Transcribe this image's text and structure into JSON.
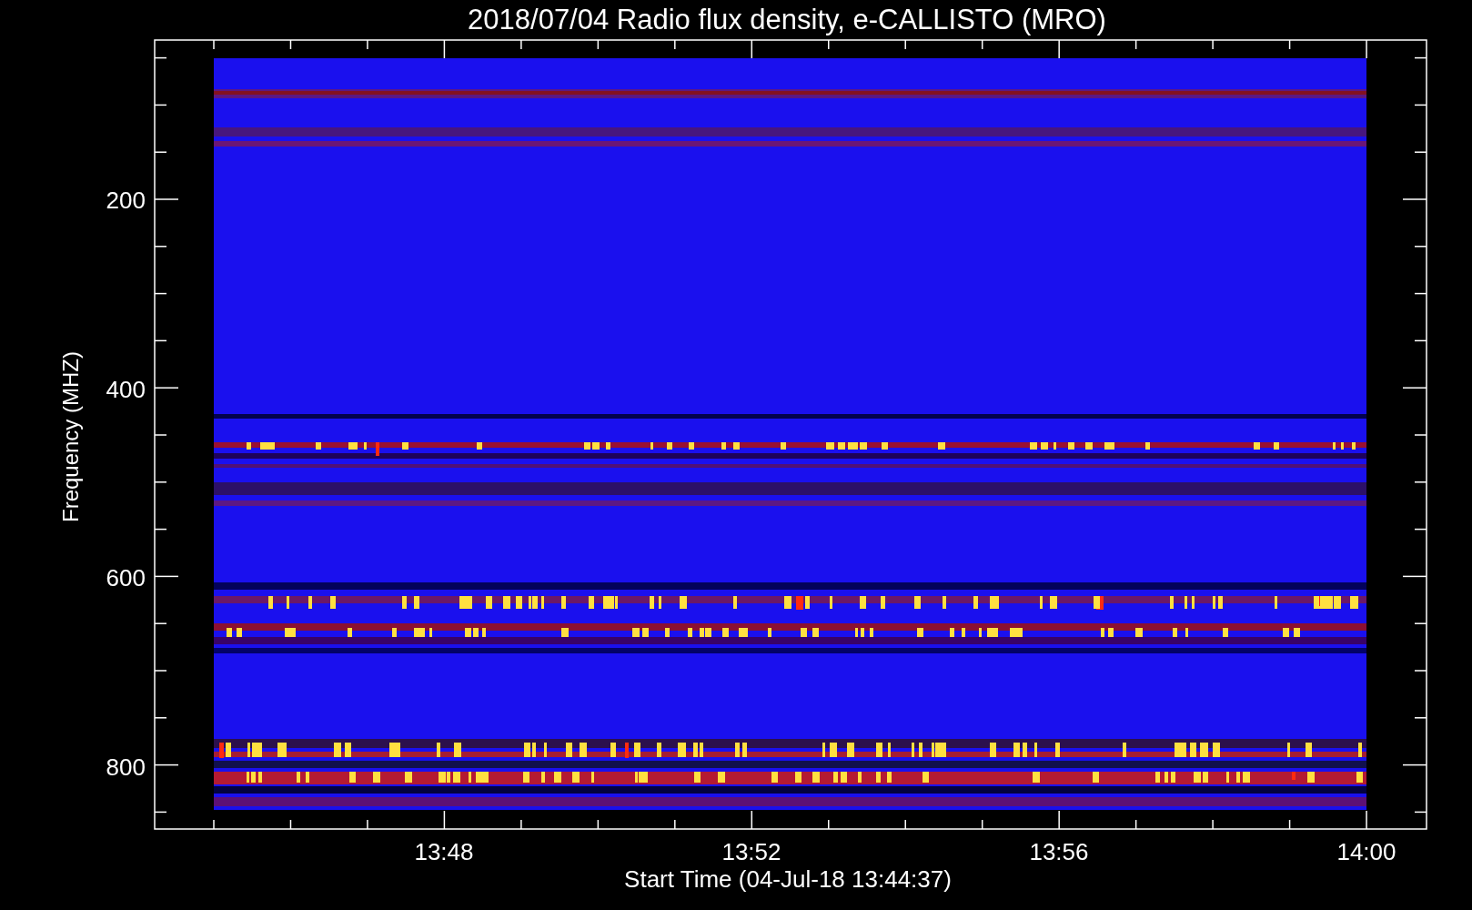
{
  "title": "2018/07/04  Radio flux density, e-CALLISTO (MRO)",
  "ylabel": "Frequency (MHZ)",
  "xlabel": "Start Time (04-Jul-18 13:44:37)",
  "yticks": [
    "200",
    "400",
    "600",
    "800"
  ],
  "xticks": [
    "13:48",
    "13:52",
    "13:56",
    "14:00"
  ]
}
